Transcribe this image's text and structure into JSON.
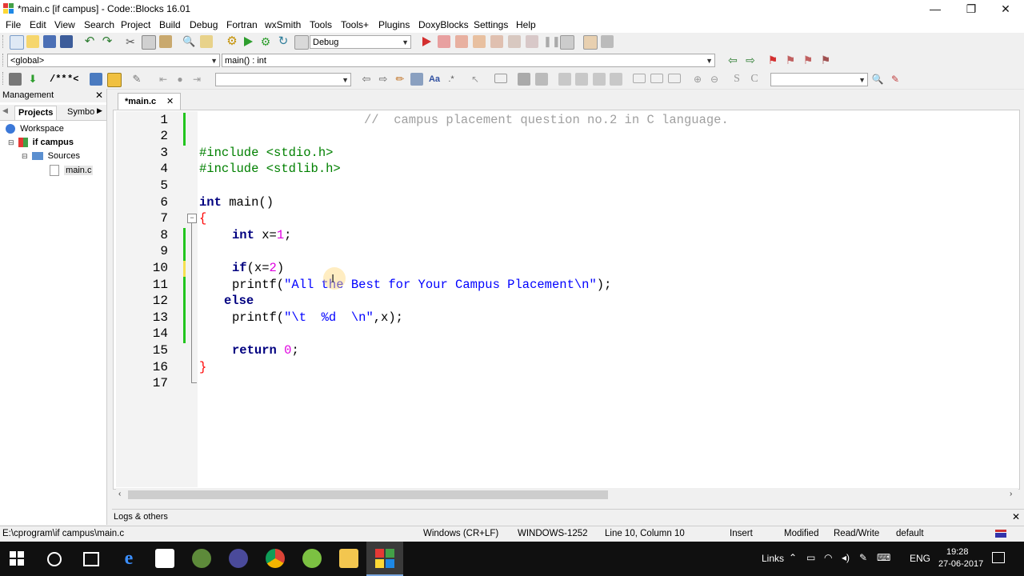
{
  "window": {
    "title": "*main.c [if campus] - Code::Blocks 16.01",
    "controls": {
      "minimize": "—",
      "restore": "❐",
      "close": "✕"
    }
  },
  "menu": [
    "File",
    "Edit",
    "View",
    "Search",
    "Project",
    "Build",
    "Debug",
    "Fortran",
    "wxSmith",
    "Tools",
    "Tools+",
    "Plugins",
    "DoxyBlocks",
    "Settings",
    "Help"
  ],
  "toolbar": {
    "build_target": "Debug",
    "scope": "<global>",
    "function": "main() : int",
    "comment_btn": "/**",
    "line_comment_btn": "*<"
  },
  "management": {
    "title": "Management",
    "close": "✕",
    "tabs": [
      "Projects",
      "Symbo"
    ],
    "tree": {
      "workspace": "Workspace",
      "project": "if campus",
      "folder": "Sources",
      "file": "main.c"
    }
  },
  "editor": {
    "tab_label": "*main.c",
    "tab_close": "✕",
    "line_numbers": [
      "1",
      "2",
      "3",
      "4",
      "5",
      "6",
      "7",
      "8",
      "9",
      "10",
      "11",
      "12",
      "13",
      "14",
      "15",
      "16",
      "17"
    ]
  },
  "code": {
    "l1": "//  campus placement question no.2 in C language.",
    "l3": "#include <stdio.h>",
    "l4": "#include <stdlib.h>",
    "l6_kw": "int",
    "l6_rest": " main()",
    "l7": "{",
    "l8_kw": "int",
    "l8_a": " x=",
    "l8_num": "1",
    "l8_b": ";",
    "l10_kw": "if",
    "l10_a": "(x=",
    "l10_num": "2",
    "l10_b": ")",
    "l11_a": "printf(",
    "l11_str": "\"All the Best for Your Campus Placement\\n\"",
    "l11_b": ");",
    "l12_kw": "else",
    "l13_a": "printf(",
    "l13_str": "\"\\t  %d  \\n\"",
    "l13_b": ",x);",
    "l15_kw": "return",
    "l15_num": "0",
    "l15_b": ";",
    "l16": "}"
  },
  "logs": {
    "title": "Logs & others",
    "close": "✕"
  },
  "status": {
    "path": "E:\\cprogram\\if campus\\main.c",
    "eol": "Windows (CR+LF)",
    "encoding": "WINDOWS-1252",
    "position": "Line 10, Column 10",
    "mode": "Insert",
    "modified": "Modified",
    "access": "Read/Write",
    "lang": "default"
  },
  "taskbar": {
    "links": "Links",
    "lang": "ENG",
    "time": "19:28",
    "date": "27-06-2017"
  },
  "colors": {
    "keyword": "#000080",
    "preprocessor": "#008000",
    "string": "#0000ff",
    "number": "#e000e0",
    "comment": "#a0a0a0",
    "change_marker": "#22c51e"
  }
}
